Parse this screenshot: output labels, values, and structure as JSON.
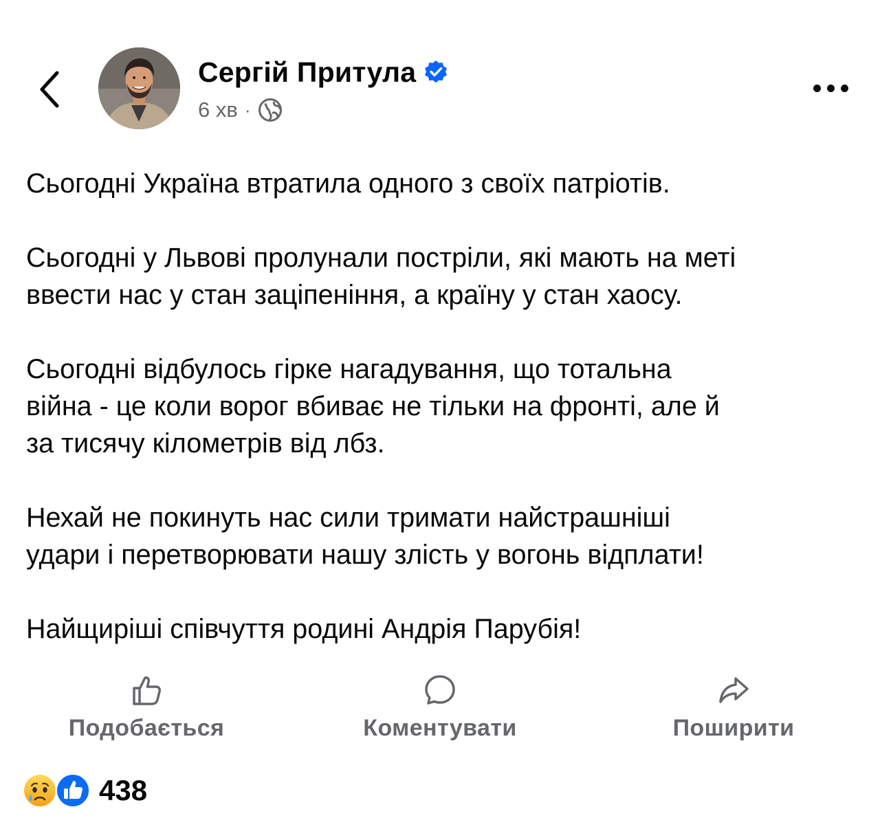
{
  "header": {
    "author_name": "Сергій Притула",
    "timestamp": "6 хв",
    "separator": "·",
    "back_icon": "chevron-left-icon",
    "verified_icon": "verified-badge-icon",
    "audience_icon": "globe-icon",
    "more_icon": "more-dots-icon"
  },
  "post": {
    "paragraphs": [
      "Сьогодні Україна втратила одного з своїх патріотів.",
      "Сьогодні у Львові пролунали постріли, які мають на меті\nввести нас у стан заціпеніння, а країну у стан хаосу.",
      "Сьогодні відбулось гірке нагадування, що тотальна\nвійна - це коли ворог вбиває не тільки на фронті, але й\nза тисячу кілометрів від лбз.",
      "Нехай не покинуть нас сили тримати найстрашніші\nудари і перетворювати нашу злість у вогонь відплати!",
      "Найщиріші співчуття родині Андрія Парубія!"
    ]
  },
  "actions": {
    "like_label": "Подобається",
    "comment_label": "Коментувати",
    "share_label": "Поширити",
    "like_icon": "thumbs-up-icon",
    "comment_icon": "comment-bubble-icon",
    "share_icon": "share-arrow-icon"
  },
  "reactions": {
    "count": "438",
    "icons": [
      "sad-reaction-icon",
      "like-reaction-icon"
    ]
  },
  "colors": {
    "text": "#080809",
    "secondary": "#65676b",
    "accent_blue": "#0866ff",
    "sad_yellow": "#f7b125"
  }
}
